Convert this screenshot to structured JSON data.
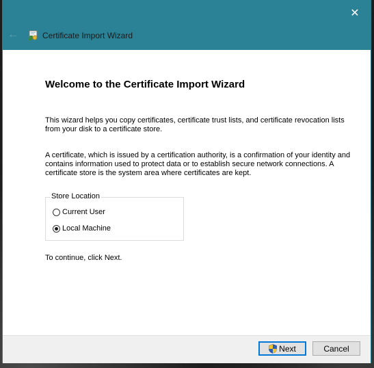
{
  "window": {
    "title": "Certificate Import Wizard",
    "close_glyph": "✕",
    "back_glyph": "←"
  },
  "page": {
    "heading": "Welcome to the Certificate Import Wizard",
    "paragraph_1": "This wizard helps you copy certificates, certificate trust lists, and certificate revocation lists from your disk to a certificate store.",
    "paragraph_2": "A certificate, which is issued by a certification authority, is a confirmation of your identity and contains information used to protect data or to establish secure network connections. A certificate store is the system area where certificates are kept.",
    "store_location": {
      "legend": "Store Location",
      "options": [
        {
          "label": "Current User",
          "selected": false
        },
        {
          "label": "Local Machine",
          "selected": true
        }
      ]
    },
    "continue_text": "To continue, click Next."
  },
  "footer": {
    "next_label": "Next",
    "cancel_label": "Cancel"
  },
  "icons": {
    "wizard": "certificate-wizard-icon",
    "back": "back-arrow-icon",
    "close": "close-icon",
    "uac": "uac-shield-icon"
  },
  "colors": {
    "titlebar": "#2b8195",
    "accent": "#0078d7"
  }
}
